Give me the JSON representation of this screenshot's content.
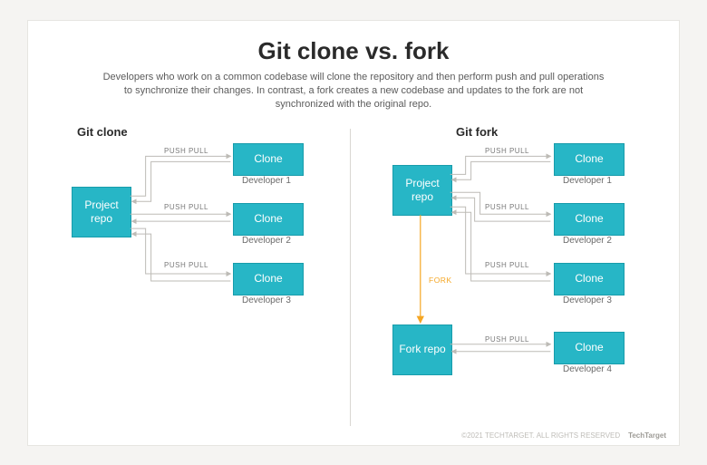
{
  "header": {
    "title": "Git clone vs. fork",
    "subtitle": "Developers who work on a common codebase will clone the repository and then perform push and pull operations to synchronize their changes. In contrast, a fork creates a new codebase and updates to the fork are not synchronized with the original repo."
  },
  "left": {
    "title": "Git clone",
    "source": "Project repo",
    "edge_label": "PUSH PULL",
    "clones": [
      {
        "box": "Clone",
        "caption": "Developer 1"
      },
      {
        "box": "Clone",
        "caption": "Developer 2"
      },
      {
        "box": "Clone",
        "caption": "Developer 3"
      }
    ]
  },
  "right": {
    "title": "Git fork",
    "source": "Project repo",
    "fork_box": "Fork repo",
    "fork_label": "FORK",
    "edge_label": "PUSH PULL",
    "clones": [
      {
        "box": "Clone",
        "caption": "Developer 1"
      },
      {
        "box": "Clone",
        "caption": "Developer 2"
      },
      {
        "box": "Clone",
        "caption": "Developer 3"
      },
      {
        "box": "Clone",
        "caption": "Developer 4"
      }
    ]
  },
  "footer": {
    "copyright": "©2021 TECHTARGET. ALL RIGHTS RESERVED",
    "brand": "TechTarget"
  },
  "colors": {
    "box_fill": "#27b6c6",
    "arrow": "#bdbbb6",
    "fork_arrow": "#f5a623"
  }
}
